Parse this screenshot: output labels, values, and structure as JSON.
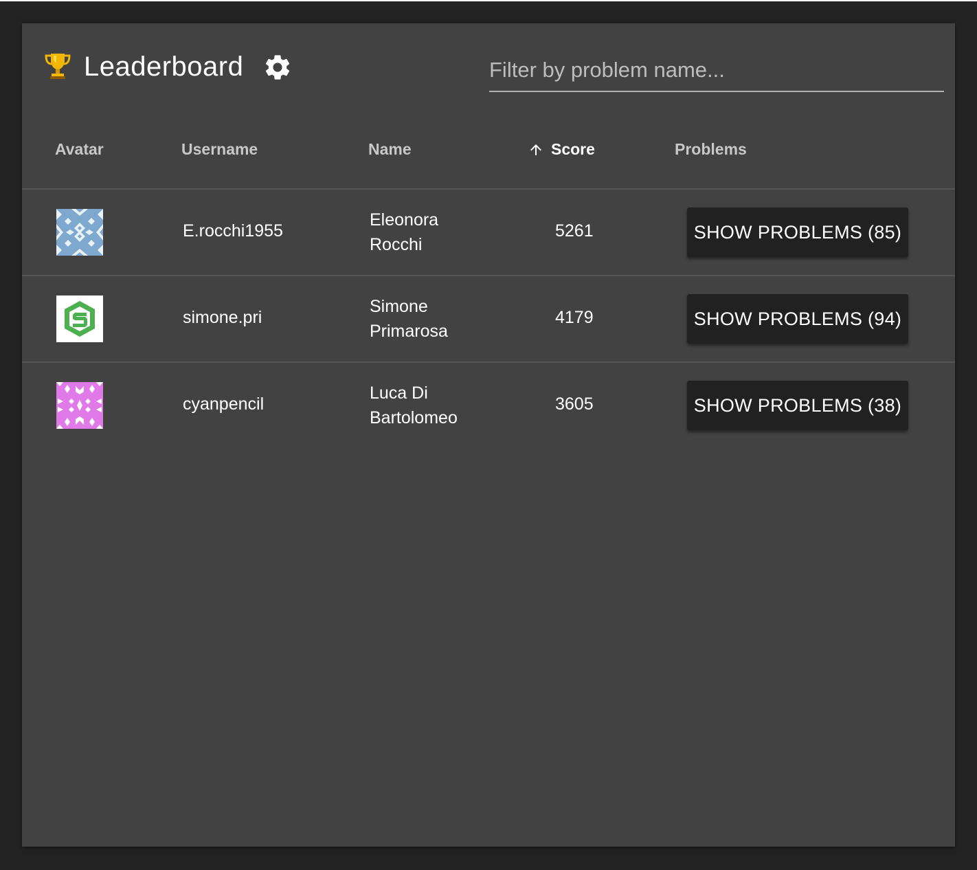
{
  "header": {
    "title": "Leaderboard",
    "filter_placeholder": "Filter by problem name..."
  },
  "columns": {
    "avatar": "Avatar",
    "username": "Username",
    "name": "Name",
    "score": "Score",
    "problems": "Problems"
  },
  "sort": {
    "column": "score",
    "direction": "ascending-arrow"
  },
  "rows": [
    {
      "avatar_icon": "identicon-blue-diamond-pattern",
      "username": "E.rocchi1955",
      "name": "Eleonora Rocchi",
      "score": "5261",
      "button_label": "SHOW PROBLEMS (85)"
    },
    {
      "avatar_icon": "green-s-logo",
      "username": "simone.pri",
      "name": "Simone Primarosa",
      "score": "4179",
      "button_label": "SHOW PROBLEMS (94)"
    },
    {
      "avatar_icon": "identicon-magenta-pattern",
      "username": "cyanpencil",
      "name": "Luca Di Bartolomeo",
      "score": "3605",
      "button_label": "SHOW PROBLEMS (38)"
    }
  ],
  "colors": {
    "page_background": "#232323",
    "panel_background": "#424242",
    "button_background": "#212121",
    "text": "#ffffff",
    "header_text": "#c8c8c8"
  }
}
